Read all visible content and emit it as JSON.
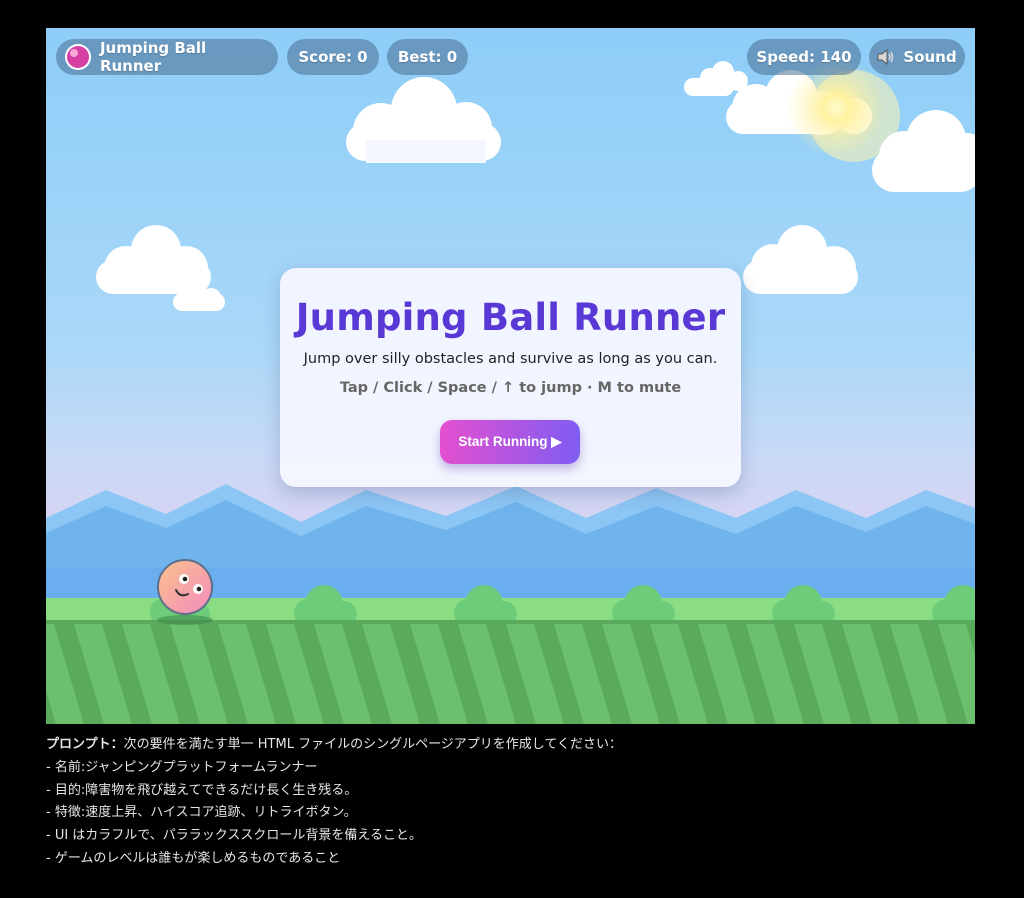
{
  "hud": {
    "title": "Jumping Ball Runner",
    "score_label": "Score: 0",
    "best_label": "Best: 0",
    "speed_label": "Speed: 140",
    "sound_label": "Sound",
    "sound_icon": "speaker-icon",
    "logo_icon": "pink-ball-icon"
  },
  "game_state": {
    "score": 0,
    "best": 0,
    "speed": 140,
    "sound_on": true
  },
  "modal": {
    "title": "Jumping Ball Runner",
    "description": "Jump over silly obstacles and survive as long as you can.",
    "controls": "Tap / Click / Space / ↑ to jump · M to mute",
    "start_label": "Start Running ▶"
  },
  "colors": {
    "sky_top": "#8dcdf8",
    "mountains": "#6fb3ee",
    "grass": "#6cbf6c",
    "ball": "#f6a0b6",
    "title": "#5a38d6",
    "button_start": "#e44fcf",
    "button_end": "#7f5cf2"
  },
  "prompt": {
    "heading": "プロンプト：",
    "intro": "次の要件を満たす単一 HTML ファイルのシングルページアプリを作成してください：",
    "items": [
      "- 名前:ジャンピングプラットフォームランナー",
      "- 目的:障害物を飛び越えてできるだけ長く生き残る。",
      "- 特徴:速度上昇、ハイスコア追跡、リトライボタン。",
      "- UI はカラフルで、パララックススクロール背景を備えること。",
      "- ゲームのレベルは誰もが楽しめるものであること"
    ]
  }
}
